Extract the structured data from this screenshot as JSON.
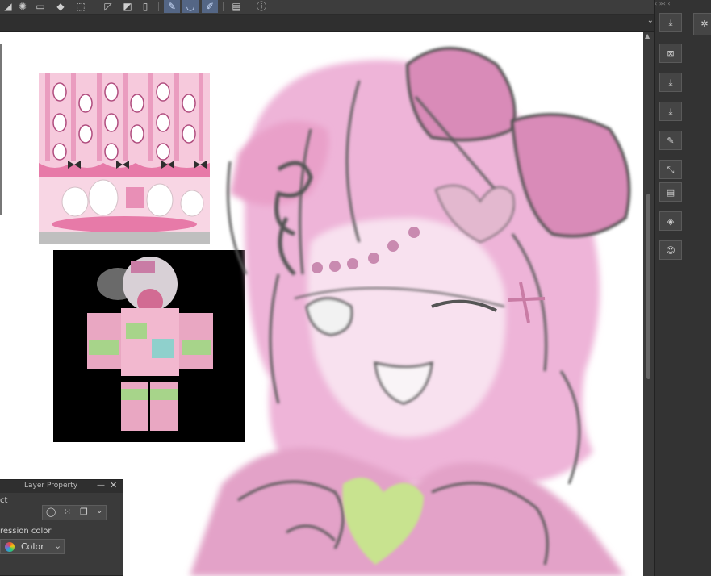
{
  "toolbar": {
    "icons": [
      "snap-icon",
      "dotted-circle-icon",
      "select-icon",
      "fill-icon",
      "transform-icon",
      "ruler-icon",
      "gradient-icon",
      "frame-icon",
      "pen-pressure-icon",
      "curve-icon",
      "edit-icon",
      "device-icon",
      "help-icon"
    ],
    "active_color": "#546685"
  },
  "subbar": {
    "chevron": "⌄"
  },
  "right_panel": {
    "top_arrows": "‹  »‹  ‹",
    "buttons": [
      "import-layer-icon",
      "merge-icon",
      "download-icon",
      "download-alt-icon",
      "edit-layer-icon",
      "transform-layer-icon",
      "folder-icon",
      "layer-3d-icon",
      "figure-icon",
      "material-icon"
    ]
  },
  "layer_property": {
    "title": "Layer Property",
    "minimize": "—",
    "close": "✕",
    "effect_label": "ct",
    "expression_label": "ression color",
    "color_value": "Color",
    "chevron": "⌄"
  },
  "colors": {
    "canvas": "#ffffff",
    "pink": "#e8a6cf",
    "dark_pink": "#c77aa8",
    "sketch_line": "#555555",
    "heart_green": "#c8e38f"
  }
}
